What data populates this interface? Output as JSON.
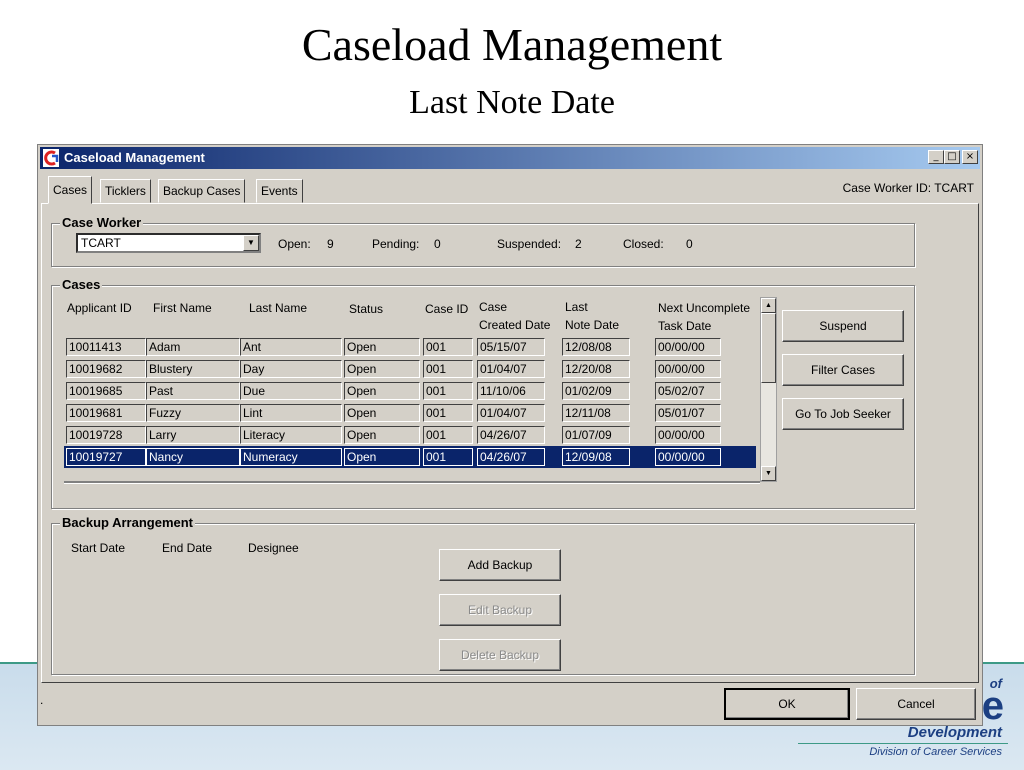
{
  "slide": {
    "title": "Caseload Management",
    "subtitle": "Last Note Date",
    "brand_of": "of",
    "brand_e": "e",
    "brand_development": "Development",
    "brand_division": "Division of Career Services"
  },
  "window": {
    "title": "Caseload Management",
    "icon": "app-logo-icon",
    "controls": {
      "minimize": "_",
      "maximize": "□",
      "close": "×"
    }
  },
  "tabs": [
    {
      "label": "Cases",
      "active": true
    },
    {
      "label": "Ticklers"
    },
    {
      "label": "Backup Cases"
    },
    {
      "label": "Events"
    }
  ],
  "case_worker_id": "Case Worker ID: TCART",
  "case_worker": {
    "group_title": "Case Worker",
    "selected": "TCART",
    "open_label": "Open:",
    "open_count": "9",
    "pending_label": "Pending:",
    "pending_count": "0",
    "suspended_label": "Suspended:",
    "suspended_count": "2",
    "closed_label": "Closed:",
    "closed_count": "0"
  },
  "cases": {
    "group_title": "Cases",
    "columns": {
      "applicant_id": "Applicant ID",
      "first_name": "First Name",
      "last_name": "Last Name",
      "status": "Status",
      "case_id": "Case ID",
      "created_1": "Case",
      "created_2": "Created Date",
      "last_note_1": "Last",
      "last_note_2": "Note Date",
      "next_task_1": "Next Uncomplete",
      "next_task_2": "Task Date"
    },
    "rows": [
      [
        "10011413",
        "Adam",
        "Ant",
        "Open",
        "001",
        "05/15/07",
        "12/08/08",
        "00/00/00"
      ],
      [
        "10019682",
        "Blustery",
        "Day",
        "Open",
        "001",
        "01/04/07",
        "12/20/08",
        "00/00/00"
      ],
      [
        "10019685",
        "Past",
        "Due",
        "Open",
        "001",
        "11/10/06",
        "01/02/09",
        "05/02/07"
      ],
      [
        "10019681",
        "Fuzzy",
        "Lint",
        "Open",
        "001",
        "01/04/07",
        "12/11/08",
        "05/01/07"
      ],
      [
        "10019728",
        "Larry",
        "Literacy",
        "Open",
        "001",
        "04/26/07",
        "01/07/09",
        "00/00/00"
      ],
      [
        "10019727",
        "Nancy",
        "Numeracy",
        "Open",
        "001",
        "04/26/07",
        "12/09/08",
        "00/00/00"
      ]
    ],
    "selected_row": 5
  },
  "side_buttons": {
    "suspend": "Suspend",
    "filter": "Filter Cases",
    "goto": "Go To Job Seeker"
  },
  "backup": {
    "group_title": "Backup Arrangement",
    "start_date": "Start Date",
    "end_date": "End Date",
    "designee": "Designee",
    "add": "Add Backup",
    "edit": "Edit Backup",
    "delete": "Delete Backup"
  },
  "footer": {
    "status_text": ".",
    "ok": "OK",
    "cancel": "Cancel"
  }
}
